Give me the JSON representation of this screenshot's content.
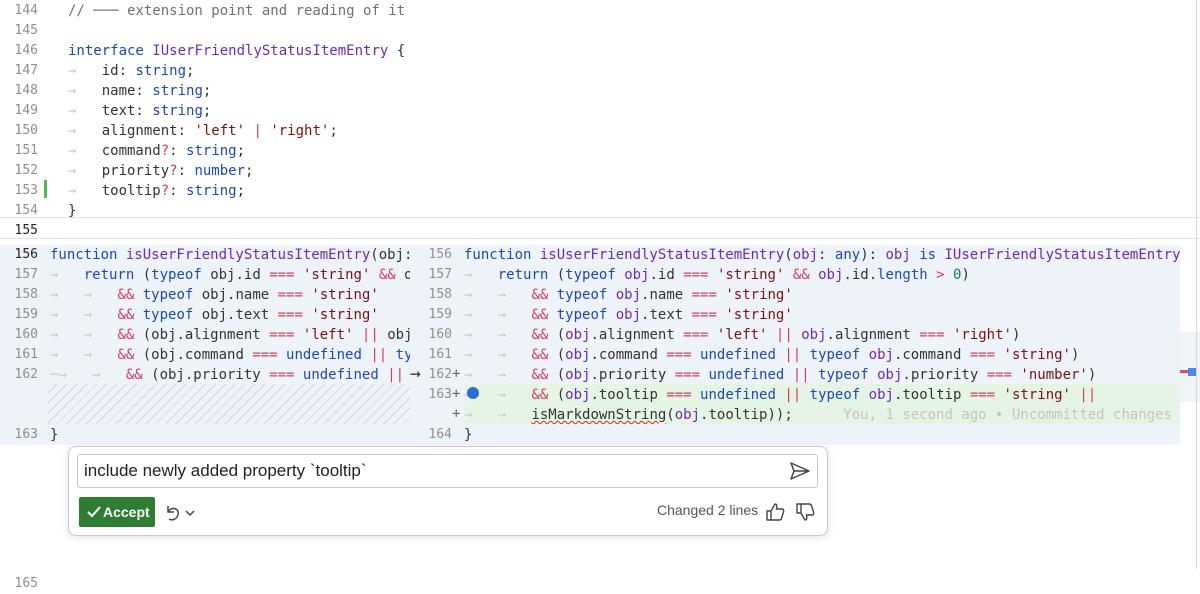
{
  "editor": {
    "lines_top": [
      {
        "n": "144",
        "segs": [
          [
            "cm",
            "// ─── extension point and reading of it"
          ]
        ]
      },
      {
        "n": "145",
        "segs": []
      },
      {
        "n": "146",
        "segs": [
          [
            "kw",
            "interface "
          ],
          [
            "fn",
            "IUserFriendlyStatusItemEntry"
          ],
          [
            "",
            " {"
          ]
        ]
      },
      {
        "n": "147",
        "segs": [
          [
            "ws",
            "→   "
          ],
          [
            "",
            "id: "
          ],
          [
            "ty",
            "string"
          ],
          [
            "",
            ";"
          ]
        ]
      },
      {
        "n": "148",
        "segs": [
          [
            "ws",
            "→   "
          ],
          [
            "",
            "name: "
          ],
          [
            "ty",
            "string"
          ],
          [
            "",
            ";"
          ]
        ]
      },
      {
        "n": "149",
        "segs": [
          [
            "ws",
            "→   "
          ],
          [
            "",
            "text: "
          ],
          [
            "ty",
            "string"
          ],
          [
            "",
            ";"
          ]
        ]
      },
      {
        "n": "150",
        "segs": [
          [
            "ws",
            "→   "
          ],
          [
            "",
            "alignment: "
          ],
          [
            "str",
            "'left'"
          ],
          [
            "op",
            " | "
          ],
          [
            "str",
            "'right'"
          ],
          [
            "",
            ";"
          ]
        ]
      },
      {
        "n": "151",
        "segs": [
          [
            "ws",
            "→   "
          ],
          [
            "",
            "command"
          ],
          [
            "op",
            "?"
          ],
          [
            "",
            ": "
          ],
          [
            "ty",
            "string"
          ],
          [
            "",
            ";"
          ]
        ]
      },
      {
        "n": "152",
        "segs": [
          [
            "ws",
            "→   "
          ],
          [
            "",
            "priority"
          ],
          [
            "op",
            "?"
          ],
          [
            "",
            ": "
          ],
          [
            "ty",
            "number"
          ],
          [
            "",
            ";"
          ]
        ]
      },
      {
        "n": "153",
        "segs": [
          [
            "ws",
            "→   "
          ],
          [
            "",
            "tooltip"
          ],
          [
            "op",
            "?"
          ],
          [
            "",
            ": "
          ],
          [
            "ty",
            "string"
          ],
          [
            "",
            ";"
          ]
        ]
      },
      {
        "n": "154",
        "segs": [
          [
            "",
            "}"
          ]
        ]
      },
      {
        "n": "155",
        "segs": []
      }
    ],
    "left_pane": [
      {
        "n": "156",
        "segs": [
          [
            "kw",
            "function "
          ],
          [
            "fn",
            "isUserFriendlyStatusItemEntry"
          ],
          [
            "",
            "(obj: "
          ],
          [
            "kw",
            "an"
          ]
        ]
      },
      {
        "n": "157",
        "segs": [
          [
            "ws",
            "→   "
          ],
          [
            "kw",
            "return "
          ],
          [
            "",
            "("
          ],
          [
            "kw",
            "typeof "
          ],
          [
            "",
            "obj.id "
          ],
          [
            "op",
            "==="
          ],
          [
            "",
            " "
          ],
          [
            "str",
            "'string'"
          ],
          [
            "",
            " "
          ],
          [
            "op",
            "&&"
          ],
          [
            "",
            " obj."
          ]
        ]
      },
      {
        "n": "158",
        "segs": [
          [
            "ws",
            "→   →   "
          ],
          [
            "op",
            "&&"
          ],
          [
            "",
            " "
          ],
          [
            "kw",
            "typeof "
          ],
          [
            "",
            "obj.name "
          ],
          [
            "op",
            "==="
          ],
          [
            "",
            " "
          ],
          [
            "str",
            "'string'"
          ]
        ]
      },
      {
        "n": "159",
        "segs": [
          [
            "ws",
            "→   →   "
          ],
          [
            "op",
            "&&"
          ],
          [
            "",
            " "
          ],
          [
            "kw",
            "typeof "
          ],
          [
            "",
            "obj.text "
          ],
          [
            "op",
            "==="
          ],
          [
            "",
            " "
          ],
          [
            "str",
            "'string'"
          ]
        ]
      },
      {
        "n": "160",
        "segs": [
          [
            "ws",
            "→   →   "
          ],
          [
            "op",
            "&&"
          ],
          [
            "",
            " (obj.alignment "
          ],
          [
            "op",
            "==="
          ],
          [
            "",
            " "
          ],
          [
            "str",
            "'left'"
          ],
          [
            "",
            " "
          ],
          [
            "op",
            "||"
          ],
          [
            "",
            " obj.al"
          ]
        ]
      },
      {
        "n": "161",
        "segs": [
          [
            "ws",
            "→   →   "
          ],
          [
            "op",
            "&&"
          ],
          [
            "",
            " (obj.command "
          ],
          [
            "op",
            "==="
          ],
          [
            "",
            " "
          ],
          [
            "kw",
            "undefined"
          ],
          [
            "",
            " "
          ],
          [
            "op",
            "||"
          ],
          [
            "",
            " "
          ],
          [
            "kw",
            "typeo"
          ]
        ]
      },
      {
        "n": "162",
        "segs": [
          [
            "ws",
            "─→   →   "
          ],
          [
            "op",
            "&&"
          ],
          [
            "",
            " (obj.priority "
          ],
          [
            "op",
            "==="
          ],
          [
            "",
            " "
          ],
          [
            "kw",
            "undefined"
          ],
          [
            "",
            " "
          ],
          [
            "op",
            "||"
          ],
          [
            "",
            " "
          ],
          [
            "kw",
            "type"
          ]
        ]
      },
      {
        "n": "",
        "segs": []
      },
      {
        "n": "",
        "segs": []
      },
      {
        "n": "163",
        "segs": [
          [
            "",
            "}"
          ]
        ]
      }
    ],
    "right_pane": [
      {
        "n": "156",
        "segs": [
          [
            "kw",
            "function "
          ],
          [
            "fn",
            "isUserFriendlyStatusItemEntry"
          ],
          [
            "",
            "("
          ],
          [
            "fn",
            "obj"
          ],
          [
            "",
            ": "
          ],
          [
            "kw",
            "any"
          ],
          [
            "",
            "): "
          ],
          [
            "fn",
            "obj "
          ],
          [
            "kw",
            "is "
          ],
          [
            "fn",
            "IUserFriendlyStatusItemEntry"
          ],
          [
            "",
            " {"
          ]
        ]
      },
      {
        "n": "157",
        "segs": [
          [
            "ws",
            "→   "
          ],
          [
            "kw",
            "return "
          ],
          [
            "",
            "("
          ],
          [
            "kw",
            "typeof "
          ],
          [
            "fn",
            "obj"
          ],
          [
            "",
            ".id "
          ],
          [
            "op",
            "==="
          ],
          [
            "",
            " "
          ],
          [
            "str",
            "'string'"
          ],
          [
            "",
            " "
          ],
          [
            "op",
            "&&"
          ],
          [
            "",
            " "
          ],
          [
            "fn",
            "obj"
          ],
          [
            "",
            ".id."
          ],
          [
            "kw",
            "length"
          ],
          [
            "",
            " "
          ],
          [
            "op",
            ">"
          ],
          [
            "",
            " "
          ],
          [
            "num2",
            "0"
          ],
          [
            "",
            ")"
          ]
        ]
      },
      {
        "n": "158",
        "segs": [
          [
            "ws",
            "→   →   "
          ],
          [
            "op",
            "&&"
          ],
          [
            "",
            " "
          ],
          [
            "kw",
            "typeof "
          ],
          [
            "fn",
            "obj"
          ],
          [
            "",
            ".name "
          ],
          [
            "op",
            "==="
          ],
          [
            "",
            " "
          ],
          [
            "str",
            "'string'"
          ]
        ]
      },
      {
        "n": "159",
        "segs": [
          [
            "ws",
            "→   →   "
          ],
          [
            "op",
            "&&"
          ],
          [
            "",
            " "
          ],
          [
            "kw",
            "typeof "
          ],
          [
            "fn",
            "obj"
          ],
          [
            "",
            ".text "
          ],
          [
            "op",
            "==="
          ],
          [
            "",
            " "
          ],
          [
            "str",
            "'string'"
          ]
        ]
      },
      {
        "n": "160",
        "segs": [
          [
            "ws",
            "→   →   "
          ],
          [
            "op",
            "&&"
          ],
          [
            "",
            " ("
          ],
          [
            "fn",
            "obj"
          ],
          [
            "",
            ".alignment "
          ],
          [
            "op",
            "==="
          ],
          [
            "",
            " "
          ],
          [
            "str",
            "'left'"
          ],
          [
            "",
            " "
          ],
          [
            "op",
            "||"
          ],
          [
            "",
            " "
          ],
          [
            "fn",
            "obj"
          ],
          [
            "",
            ".alignment "
          ],
          [
            "op",
            "==="
          ],
          [
            "",
            " "
          ],
          [
            "str",
            "'right'"
          ],
          [
            "",
            ")"
          ]
        ]
      },
      {
        "n": "161",
        "segs": [
          [
            "ws",
            "→   →   "
          ],
          [
            "op",
            "&&"
          ],
          [
            "",
            " ("
          ],
          [
            "fn",
            "obj"
          ],
          [
            "",
            ".command "
          ],
          [
            "op",
            "==="
          ],
          [
            "",
            " "
          ],
          [
            "kw",
            "undefined"
          ],
          [
            "",
            " "
          ],
          [
            "op",
            "||"
          ],
          [
            "",
            " "
          ],
          [
            "kw",
            "typeof "
          ],
          [
            "fn",
            "obj"
          ],
          [
            "",
            ".command "
          ],
          [
            "op",
            "==="
          ],
          [
            "",
            " "
          ],
          [
            "str",
            "'string'"
          ],
          [
            "",
            ")"
          ]
        ]
      },
      {
        "n": "162",
        "segs": [
          [
            "ws",
            "→   →   "
          ],
          [
            "op",
            "&&"
          ],
          [
            "",
            " ("
          ],
          [
            "fn",
            "obj"
          ],
          [
            "",
            ".priority "
          ],
          [
            "op",
            "==="
          ],
          [
            "",
            " "
          ],
          [
            "kw",
            "undefined"
          ],
          [
            "",
            " "
          ],
          [
            "op",
            "||"
          ],
          [
            "",
            " "
          ],
          [
            "kw",
            "typeof "
          ],
          [
            "fn",
            "obj"
          ],
          [
            "",
            ".priority "
          ],
          [
            "op",
            "==="
          ],
          [
            "",
            " "
          ],
          [
            "str",
            "'number'"
          ],
          [
            "",
            ")"
          ]
        ]
      },
      {
        "n": "163",
        "segs": [
          [
            "ws",
            "→   →   "
          ],
          [
            "op",
            "&&"
          ],
          [
            "",
            " ("
          ],
          [
            "fn",
            "obj"
          ],
          [
            "",
            ".tooltip "
          ],
          [
            "op",
            "==="
          ],
          [
            "",
            " "
          ],
          [
            "kw",
            "undefined"
          ],
          [
            "",
            " "
          ],
          [
            "op",
            "||"
          ],
          [
            "",
            " "
          ],
          [
            "kw",
            "typeof "
          ],
          [
            "fn",
            "obj"
          ],
          [
            "",
            ".tooltip "
          ],
          [
            "op",
            "==="
          ],
          [
            "",
            " "
          ],
          [
            "str",
            "'string'"
          ],
          [
            "",
            " "
          ],
          [
            "op",
            "||"
          ],
          [
            "",
            " "
          ]
        ]
      },
      {
        "n": "",
        "segs": [
          [
            "ws",
            "→   →   "
          ],
          [
            "squig",
            "isMarkdownString"
          ],
          [
            "",
            "("
          ],
          [
            "fn",
            "obj"
          ],
          [
            "",
            ".tooltip));"
          ],
          [
            "ghost",
            "      You, 1 second ago • Uncommitted changes"
          ]
        ]
      },
      {
        "n": "164",
        "segs": [
          [
            "",
            "}"
          ]
        ]
      }
    ],
    "line_165": "165",
    "arrow": "→"
  },
  "chat": {
    "prompt": "include newly added property `tooltip`",
    "accept_label": "Accept",
    "changed_label": "Changed 2 lines"
  },
  "colors": {
    "accept": "#2e7d32",
    "diff_bg": "#eef3fa",
    "added_bg": "#e6f4e6",
    "gutter_added": "#4fb84f"
  }
}
